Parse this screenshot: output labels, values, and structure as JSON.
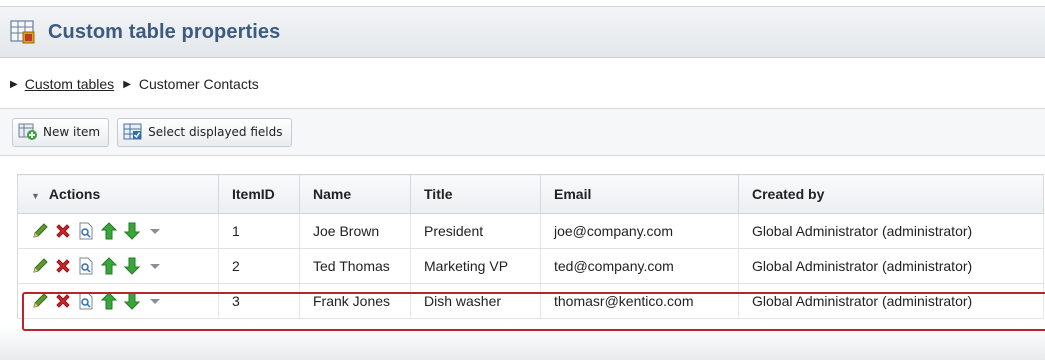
{
  "header": {
    "title": "Custom table properties"
  },
  "breadcrumb": {
    "items": [
      "Custom tables",
      "Customer Contacts"
    ]
  },
  "toolbar": {
    "new_item": "New item",
    "select_fields": "Select displayed fields"
  },
  "grid": {
    "columns": [
      "Actions",
      "ItemID",
      "Name",
      "Title",
      "Email",
      "Created by"
    ],
    "rows": [
      {
        "id": "1",
        "name": "Joe Brown",
        "title": "President",
        "email": "joe@company.com",
        "created_by": "Global Administrator (administrator)"
      },
      {
        "id": "2",
        "name": "Ted Thomas",
        "title": "Marketing VP",
        "email": "ted@company.com",
        "created_by": "Global Administrator (administrator)"
      },
      {
        "id": "3",
        "name": "Frank Jones",
        "title": "Dish washer",
        "email": "thomasr@kentico.com",
        "created_by": "Global Administrator (administrator)"
      }
    ],
    "highlighted_row": "3"
  },
  "colors": {
    "title": "#3d5a80",
    "highlight": "#c0222a",
    "edit": "#5d9a2e",
    "delete": "#d0252b",
    "arrow_green": "#3aa53a"
  }
}
